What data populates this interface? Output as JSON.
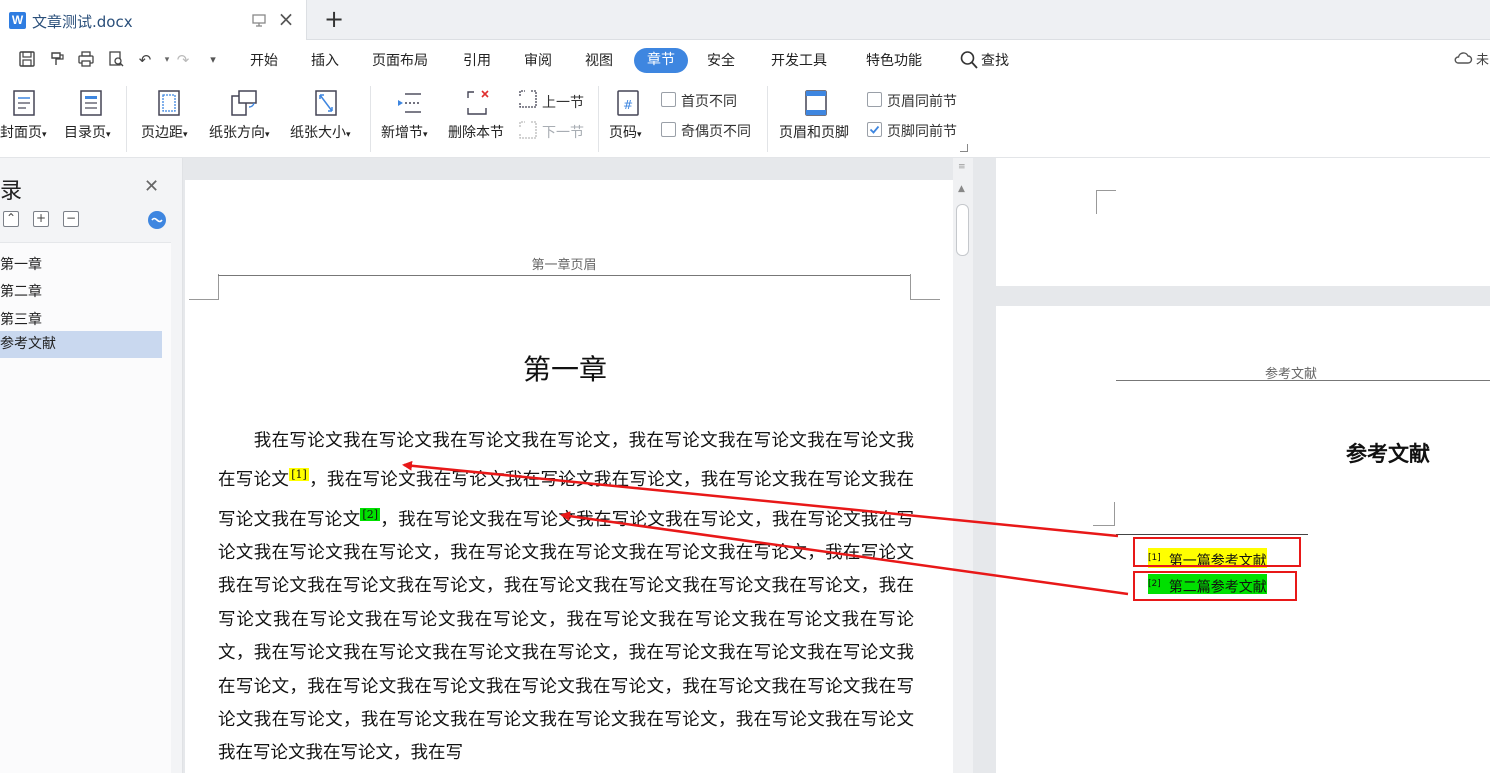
{
  "tab": {
    "title": "文章测试.docx",
    "icon_letter": "W"
  },
  "menu": {
    "items": [
      "开始",
      "插入",
      "页面布局",
      "引用",
      "审阅",
      "视图",
      "章节",
      "安全",
      "开发工具",
      "特色功能"
    ],
    "active": "章节",
    "search_label": "查找",
    "right_label": "未"
  },
  "ribbon": {
    "cover_page": "封面页",
    "toc_page": "目录页",
    "margins": "页边距",
    "orientation": "纸张方向",
    "paper_size": "纸张大小",
    "new_section": "新增节",
    "delete_section": "删除本节",
    "prev_section": "上一节",
    "next_section": "下一节",
    "page_number": "页码",
    "first_page_diff": "首页不同",
    "odd_even_diff": "奇偶页不同",
    "header_footer": "页眉和页脚",
    "header_same_as_prev": "页眉同前节",
    "footer_same_as_prev": "页脚同前节",
    "footer_same_checked": true
  },
  "toc_panel": {
    "title": "录",
    "items": [
      "第一章",
      "第二章",
      "第三章",
      "参考文献"
    ],
    "active_index": 3
  },
  "page1": {
    "header": "第一章页眉",
    "heading": "第一章",
    "text_a": "　　我在写论文我在写论文我在写论文我在写论文，我在写论文我在写论文我在写论文我在写论文",
    "cite1": "[1]",
    "text_b": "，我在写论文我在写论文我在写论文我在写论文，我在写论文我在写论文我在写论文我在写论文",
    "cite2": "[2]",
    "text_c": "，我在写论文我在写论文我在写论文我在写论文，我在写论文我在写论文我在写论文我在写论文，我在写论文我在写论文我在写论文我在写论文，我在写论文我在写论文我在写论文我在写论文，我在写论文我在写论文我在写论文我在写论文，我在写论文我在写论文我在写论文我在写论文，我在写论文我在写论文我在写论文我在写论文，我在写论文我在写论文我在写论文我在写论文，我在写论文我在写论文我在写论文我在写论文，我在写论文我在写论文我在写论文我在写论文，我在写论文我在写论文我在写论文我在写论文，我在写论文我在写论文我在写论文我在写论文，我在写论文我在写论文我在写论文我在写论文，我在写"
  },
  "page3": {
    "header": "参考文献",
    "heading": "参考文献",
    "footnotes": [
      {
        "mark": "[1]",
        "text": "第一篇参考文献"
      },
      {
        "mark": "[2]",
        "text": "第二篇参考文献"
      }
    ]
  },
  "colors": {
    "accent": "#3e86e0",
    "highlight_yellow": "#ffff00",
    "highlight_green": "#00e000",
    "annotation_red": "#e81818"
  }
}
